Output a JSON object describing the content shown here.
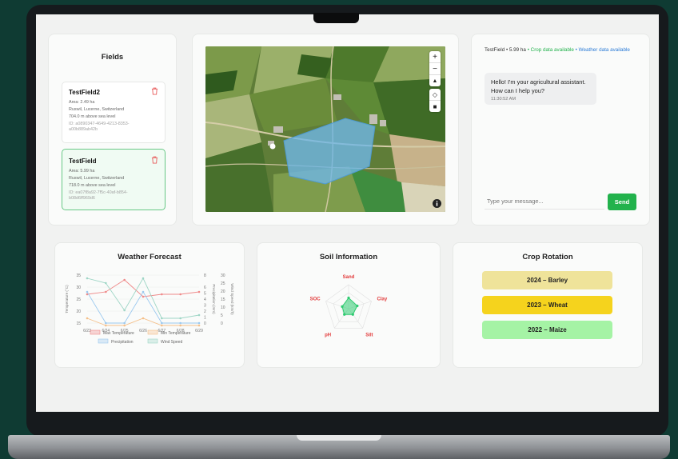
{
  "fields_panel": {
    "title": "Fields",
    "items": [
      {
        "name": "TestField2",
        "area": "Area: 2.49 ha",
        "location": "Ruswil, Lucerne, Switzerland",
        "elevation": "704.0 m above sea level",
        "id": "ID: a0890347-4649-4213-8353-a00b889ab42b"
      },
      {
        "name": "TestField",
        "area": "Area: 5.99 ha",
        "location": "Ruswil, Lucerne, Switzerland",
        "elevation": "718.0 m above sea level",
        "id": "ID: ea07f8a92-7f5c-40af-b854-b08d6ff969d6"
      }
    ]
  },
  "map": {
    "controls": [
      "+",
      "−",
      "▲",
      "◇",
      "■"
    ],
    "info_icon": "info-icon"
  },
  "chat": {
    "field_name": "TestField",
    "area": "5.99 ha",
    "crop_status": "Crop data available",
    "weather_status": "Weather data available",
    "sep": "•",
    "message": "Hello! I'm your agricultural assistant. How can I help you?",
    "time": "11:30:52 AM",
    "input_placeholder": "Type your message...",
    "send_label": "Send",
    "colors": {
      "crop": "#22b24c",
      "weather": "#2b7bd6",
      "send": "#22b24c"
    }
  },
  "weather": {
    "title": "Weather Forecast"
  },
  "soil": {
    "title": "Soil Information"
  },
  "rotation": {
    "title": "Crop Rotation",
    "items": [
      {
        "label": "2024 – Barley",
        "color": "#efe39a"
      },
      {
        "label": "2023 – Wheat",
        "color": "#f5d31d"
      },
      {
        "label": "2022 – Maize",
        "color": "#a5f3a5"
      }
    ]
  },
  "chart_data": [
    {
      "type": "line",
      "title": "Weather Forecast",
      "x": [
        "6/23",
        "6/24",
        "6/25",
        "6/26",
        "6/27",
        "6/28",
        "6/29"
      ],
      "axes": {
        "temperature": {
          "label": "Temperature (°C)",
          "ticks": [
            "15",
            "20",
            "25",
            "30",
            "35"
          ],
          "ylim": [
            15,
            35
          ]
        },
        "precipitation": {
          "label": "Precipitation (mm)",
          "ticks": [
            "0",
            "1",
            "2",
            "3",
            "4",
            "5",
            "6",
            "8"
          ],
          "ylim": [
            0,
            8
          ]
        },
        "wind": {
          "label": "Wind Speed (km/h)",
          "ticks": [
            "0",
            "5",
            "10",
            "15",
            "20",
            "25",
            "30"
          ],
          "ylim": [
            0,
            30
          ]
        }
      },
      "series": [
        {
          "name": "Max Temperature",
          "axis": "temperature",
          "values": [
            27,
            28,
            33,
            26,
            27,
            27,
            28
          ],
          "color": "#ef8a8a"
        },
        {
          "name": "Min Temperature",
          "axis": "temperature",
          "values": [
            17,
            14,
            14,
            17,
            14,
            14,
            14
          ],
          "color": "#f5c08a"
        },
        {
          "name": "Precipitation",
          "axis": "precipitation",
          "values": [
            5.2,
            0,
            0,
            5.2,
            0,
            0,
            0
          ],
          "color": "#9cc9ef"
        },
        {
          "name": "Wind Speed",
          "axis": "wind",
          "values": [
            28,
            25,
            8,
            28,
            3,
            3,
            5
          ],
          "color": "#9fd6c6"
        }
      ],
      "legend": "bottom"
    },
    {
      "type": "radar",
      "title": "Soil Information",
      "categories": [
        "Sand",
        "Clay",
        "Silt",
        "pH",
        "SOC"
      ],
      "values": [
        0.45,
        0.38,
        0.3,
        0.3,
        0.28
      ],
      "label_color": "#e23b3b",
      "fill_color": "#2ecc71"
    }
  ]
}
